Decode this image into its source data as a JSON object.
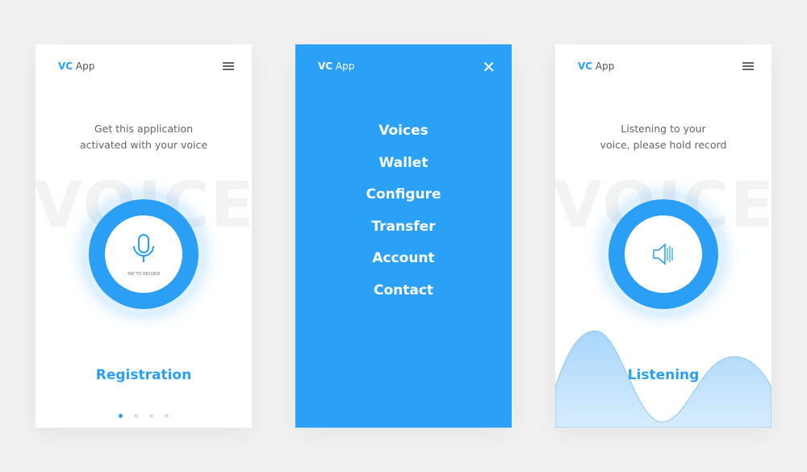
{
  "colors": {
    "accent": "#2a9ff5",
    "background": "#f1f1f1"
  },
  "screens": [
    {
      "logo_bold": "VC",
      "logo_rest": " App",
      "menu_icon": "hamburger-icon",
      "prompt": [
        "Get this application",
        "activated with your voice"
      ],
      "background_word": "VOICE",
      "button_icon": "microphone-icon",
      "button_caption": "TAP TO RECORD",
      "cta": "Registration",
      "pagination": {
        "total": 4,
        "active": 1
      }
    },
    {
      "logo_bold": "VC",
      "logo_rest": " App",
      "close_icon": "close-icon",
      "menu_items": [
        "Voices",
        "Wallet",
        "Configure",
        "Transfer",
        "Account",
        "Contact"
      ]
    },
    {
      "logo_bold": "VC",
      "logo_rest": " App",
      "menu_icon": "hamburger-icon",
      "prompt": [
        "Listening to your",
        "voice, please hold record"
      ],
      "background_word": "VOICE",
      "button_icon": "speaker-icon",
      "status": "Listening"
    }
  ]
}
